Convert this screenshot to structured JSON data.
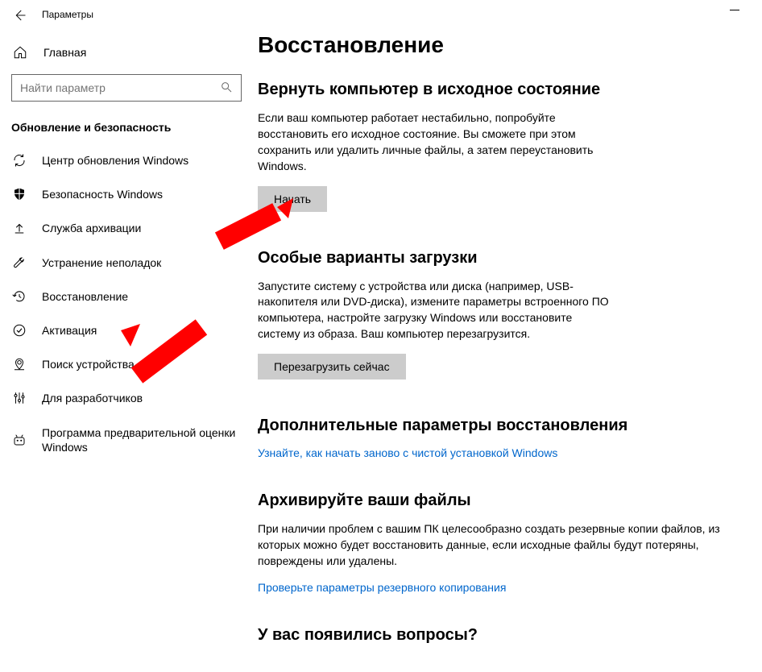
{
  "titlebar": {
    "title": "Параметры"
  },
  "sidebar": {
    "home_label": "Главная",
    "search_placeholder": "Найти параметр",
    "group_header": "Обновление и безопасность",
    "items": [
      {
        "label": "Центр обновления Windows"
      },
      {
        "label": "Безопасность Windows"
      },
      {
        "label": "Служба архивации"
      },
      {
        "label": "Устранение неполадок"
      },
      {
        "label": "Восстановление"
      },
      {
        "label": "Активация"
      },
      {
        "label": "Поиск устройства"
      },
      {
        "label": "Для разработчиков"
      },
      {
        "label": "Программа предварительной оценки Windows"
      }
    ]
  },
  "content": {
    "page_title": "Восстановление",
    "sections": {
      "reset": {
        "heading": "Вернуть компьютер в исходное состояние",
        "body": "Если ваш компьютер работает нестабильно, попробуйте восстановить его исходное состояние. Вы сможете при этом сохранить или удалить личные файлы, а затем переустановить Windows.",
        "button": "Начать"
      },
      "advanced_startup": {
        "heading": "Особые варианты загрузки",
        "body": "Запустите систему с устройства или диска (например, USB-накопителя или DVD-диска), измените параметры встроенного ПО компьютера, настройте загрузку Windows или восстановите систему из образа. Ваш компьютер перезагрузится.",
        "button": "Перезагрузить сейчас"
      },
      "more_options": {
        "heading": "Дополнительные параметры восстановления",
        "link": "Узнайте, как начать заново с чистой установкой Windows"
      },
      "backup": {
        "heading": "Архивируйте ваши файлы",
        "body": "При наличии проблем с вашим ПК целесообразно создать резервные копии файлов, из которых можно будет восстановить данные, если исходные файлы будут потеряны, повреждены или удалены.",
        "link": "Проверьте параметры резервного копирования"
      },
      "help": {
        "heading": "У вас появились вопросы?"
      }
    }
  }
}
